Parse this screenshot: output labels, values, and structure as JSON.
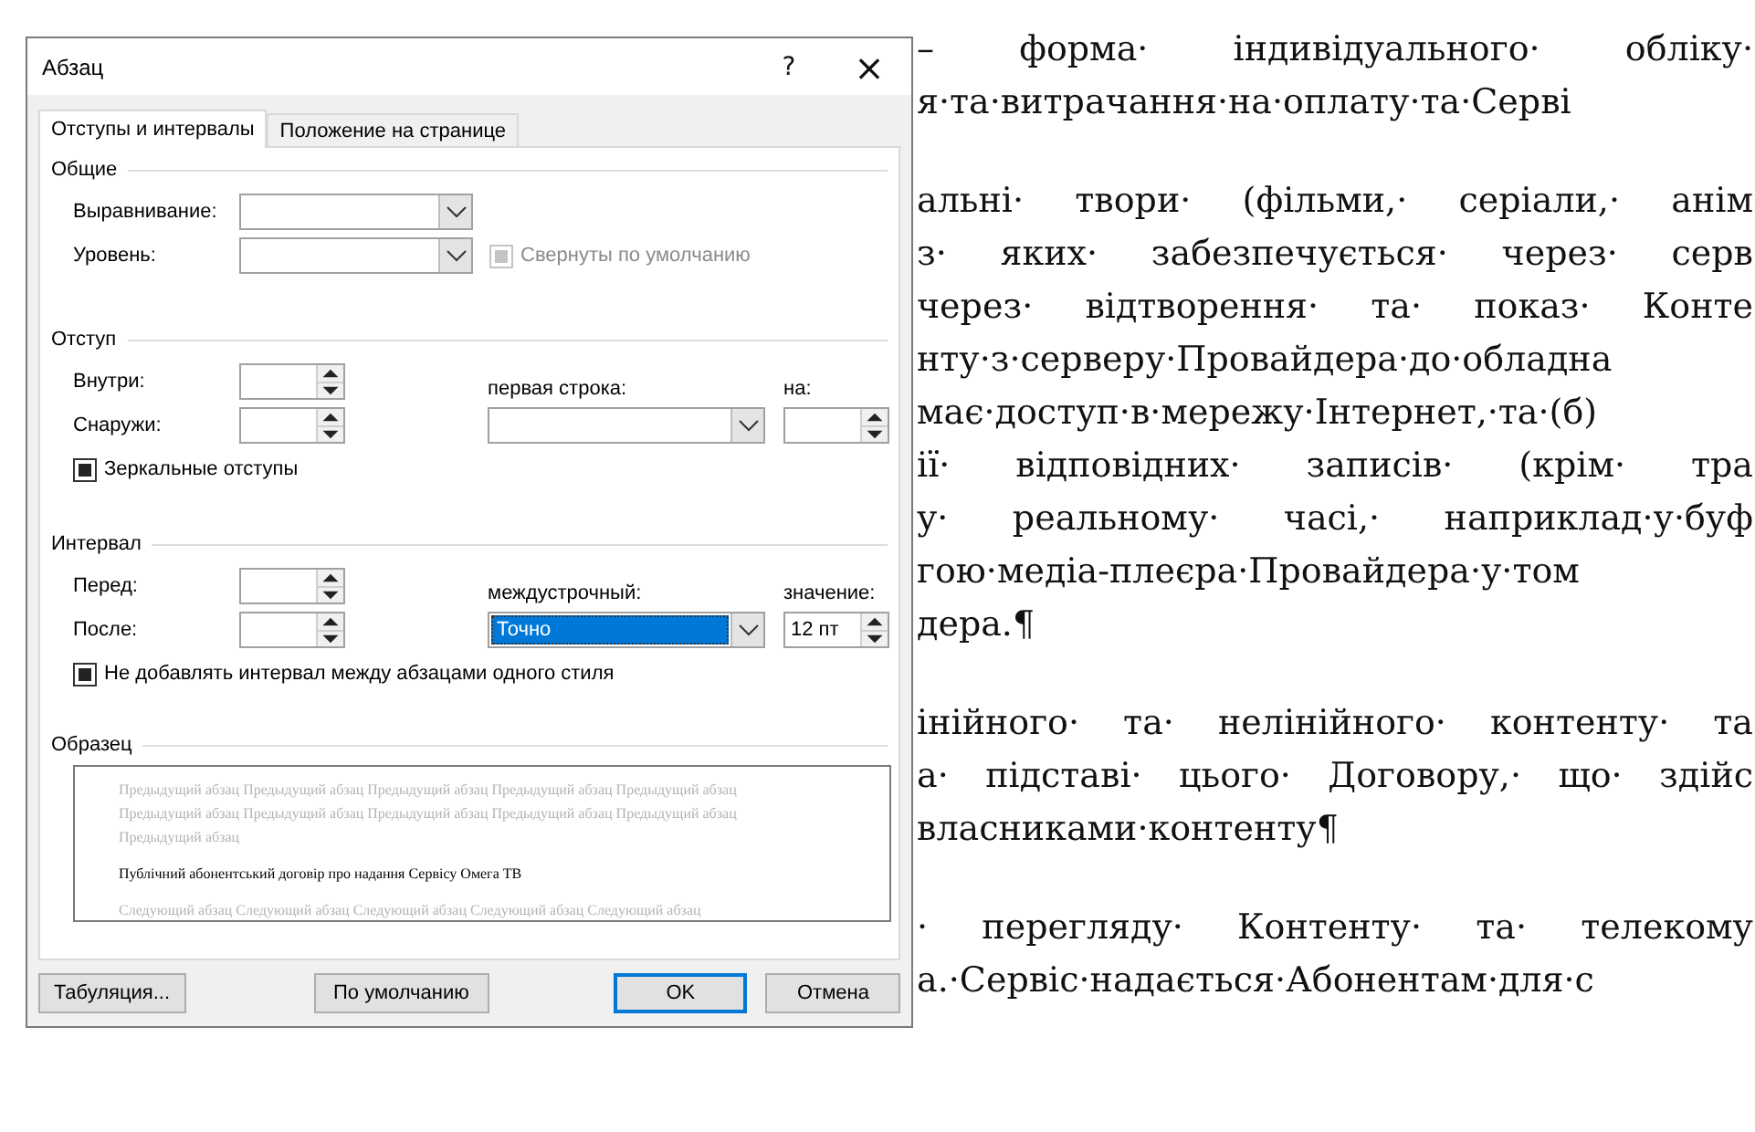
{
  "document": {
    "paragraphs": [
      {
        "lines": [
          "– форма· індивідуального· обліку·",
          "я·та·витрачання·на·оплату·та·Серві"
        ]
      },
      {
        "lines": [
          "альні· твори· (фільми,· серіали,· анім",
          "з· яких· забезпечується· через· серв",
          "через· відтворення· та· показ· Конте",
          "нту·з·серверу·Провайдера·до·обладна",
          "має·доступ·в·мережу·Інтернет,·та·(б)",
          "ії· відповідних· записів· (крім· тра",
          "у· реальному· часі,· наприклад·у·буф",
          "гою·медіа-плеєра·Провайдера·у·том",
          "дера.¶"
        ]
      },
      {
        "lines": [
          "інійного· та· нелінійного· контенту· та",
          "а· підставі· цього· Договору,· що· здійс",
          "власниками·контенту¶"
        ]
      },
      {
        "lines": [
          "· перегляду· Контенту· та· телекому",
          "а.·Сервіс·надається·Абонентам·для·с"
        ]
      }
    ]
  },
  "window": {
    "title": "Абзац",
    "help": "?",
    "close": "×"
  },
  "tabs": [
    {
      "label": "Отступы и интервалы",
      "selected": true
    },
    {
      "label": "Положение на странице",
      "selected": false
    }
  ],
  "general": {
    "title": "Общие",
    "alignment_label": "Выравнивание:",
    "level_label": "Уровень:",
    "collapsed": {
      "label": "Свернуты по умолчанию",
      "indeterminate": true,
      "disabled": true
    }
  },
  "indent": {
    "title": "Отступ",
    "inside_label": "Внутри:",
    "outside_label": "Снаружи:",
    "first_line_label": "первая строка:",
    "by_label": "на:",
    "mirror": {
      "label": "Зеркальные отступы",
      "indeterminate": true,
      "disabled": false
    }
  },
  "spacing": {
    "title": "Интервал",
    "before_label": "Перед:",
    "after_label": "После:",
    "line_spacing_label": "междустрочный:",
    "line_spacing": {
      "value": "Точно",
      "selected": true
    },
    "at_label": "значение:",
    "at_value": "12 пт",
    "no_space": {
      "label": "Не добавлять интервал между абзацами одного стиля",
      "indeterminate": true,
      "disabled": false
    }
  },
  "preview": {
    "title": "Образец",
    "previous": "Предыдущий абзац Предыдущий абзац Предыдущий абзац Предыдущий абзац Предыдущий абзац Предыдущий абзац Предыдущий абзац Предыдущий абзац Предыдущий абзац Предыдущий абзац Предыдущий абзац",
    "current": "Публічний абонентський договір про надання Сервісу Омега ТВ",
    "next": "Следующий абзац Следующий абзац Следующий абзац Следующий абзац Следующий абзац"
  },
  "buttons": [
    {
      "label": "Табуляция...",
      "default": false
    },
    {
      "label": "По умолчанию",
      "default": false
    },
    {
      "label": "OK",
      "default": true
    },
    {
      "label": "Отмена",
      "default": false
    }
  ]
}
